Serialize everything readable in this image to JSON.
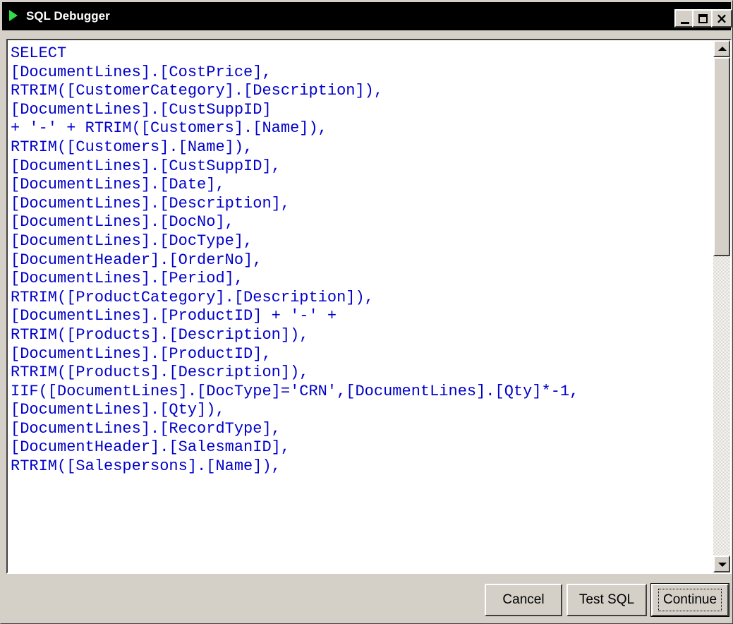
{
  "window": {
    "title": "SQL Debugger",
    "icon": "play-icon",
    "controls": {
      "minimize": "minimize",
      "maximize": "maximize",
      "close": "close"
    }
  },
  "editor": {
    "lines": [
      "SELECT",
      "[DocumentLines].[CostPrice],",
      "RTRIM([CustomerCategory].[Description]),",
      "[DocumentLines].[CustSuppID]",
      "+ '-' + RTRIM([Customers].[Name]),",
      "RTRIM([Customers].[Name]),",
      "[DocumentLines].[CustSuppID],",
      "[DocumentLines].[Date],",
      "[DocumentLines].[Description],",
      "[DocumentLines].[DocNo],",
      "[DocumentLines].[DocType],",
      "[DocumentHeader].[OrderNo],",
      "[DocumentLines].[Period],",
      "RTRIM([ProductCategory].[Description]),",
      "[DocumentLines].[ProductID] + '-' +",
      "RTRIM([Products].[Description]),",
      "[DocumentLines].[ProductID],",
      "RTRIM([Products].[Description]),",
      "IIF([DocumentLines].[DocType]='CRN',[DocumentLines].[Qty]*-1,",
      "[DocumentLines].[Qty]),",
      "[DocumentLines].[RecordType],",
      "[DocumentHeader].[SalesmanID],",
      "RTRIM([Salespersons].[Name]),"
    ],
    "text_color": "#0000cc"
  },
  "buttons": {
    "cancel": "Cancel",
    "test_sql": "Test SQL",
    "continue": "Continue"
  },
  "colors": {
    "titlebar": "#000000",
    "face": "#d4d0c8",
    "icon": "#33dd44"
  }
}
